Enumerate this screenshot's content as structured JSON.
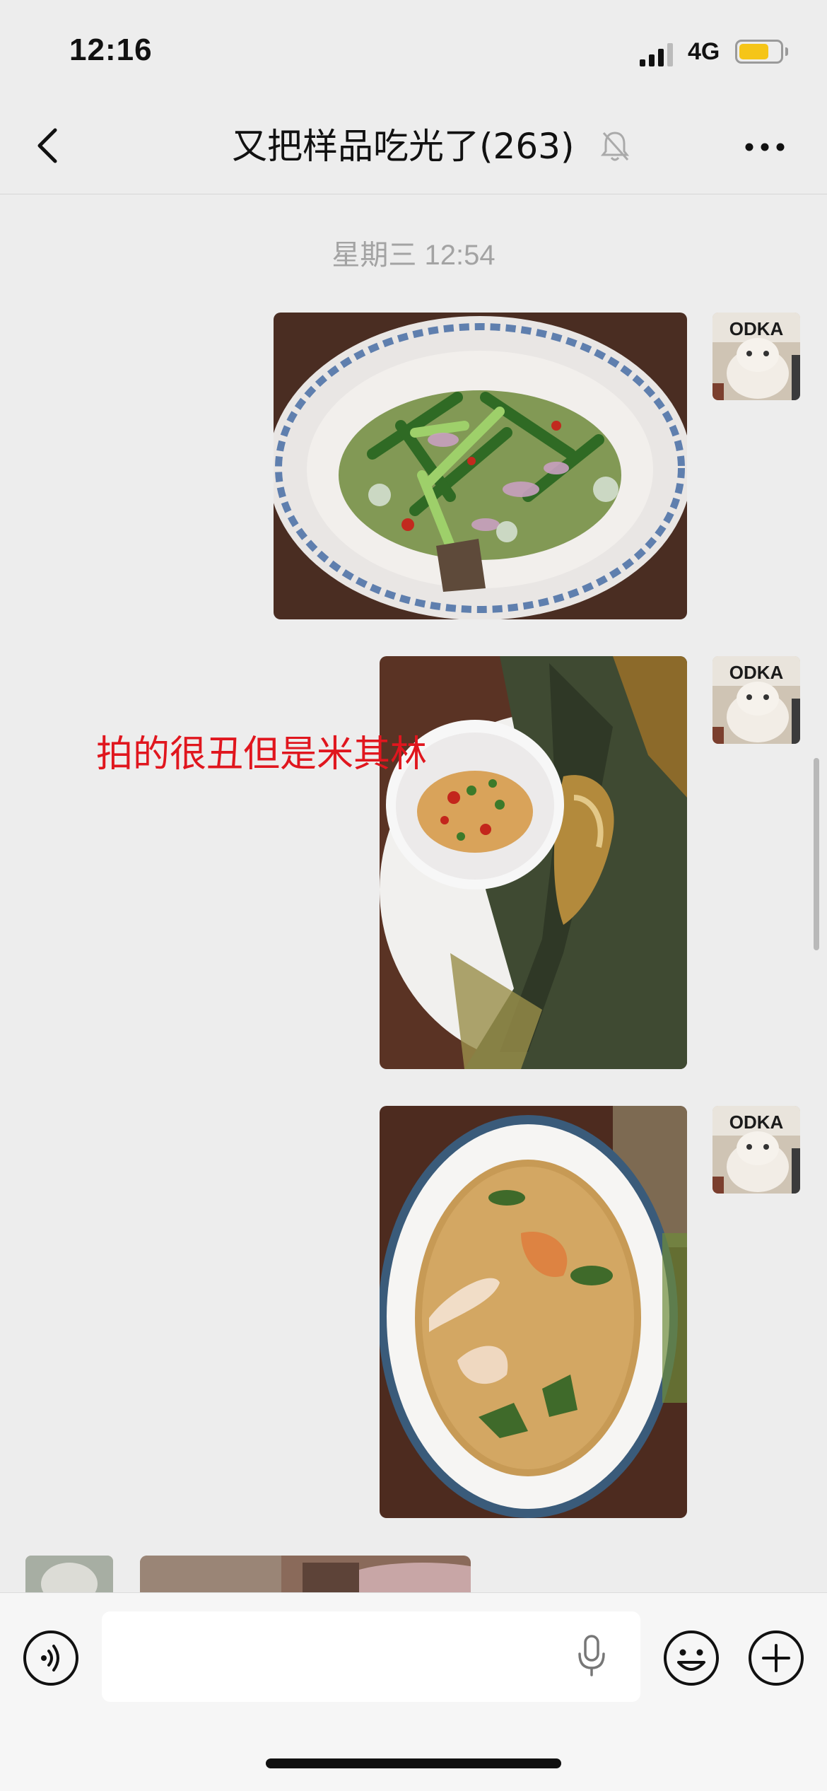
{
  "status_bar": {
    "time": "12:16",
    "network": "4G",
    "battery_color": "#f5c518",
    "battery_level": 0.75
  },
  "header": {
    "title": "又把样品吃光了(263)",
    "back_icon": "chevron-left-icon",
    "mute_icon": "bell-slash-icon",
    "more_icon": "ellipsis-icon"
  },
  "chat": {
    "timestamp": "星期三 12:54",
    "messages": [
      {
        "type": "image",
        "sender": "self",
        "subject": "salad-plate-photo"
      },
      {
        "type": "image",
        "sender": "self",
        "subject": "banana-leaf-fish-photo",
        "overlay_caption": "拍的很丑但是米其林"
      },
      {
        "type": "image",
        "sender": "self",
        "subject": "soup-bowl-photo"
      },
      {
        "type": "image",
        "sender": "other",
        "subject": "partial-photo"
      }
    ],
    "avatar_text": "ODKA"
  },
  "input_bar": {
    "voice_icon": "voice-icon",
    "mic_icon": "microphone-icon",
    "emoji_icon": "smiley-icon",
    "plus_icon": "plus-icon"
  },
  "colors": {
    "background": "#ededed",
    "caption_red": "#e0161e"
  }
}
